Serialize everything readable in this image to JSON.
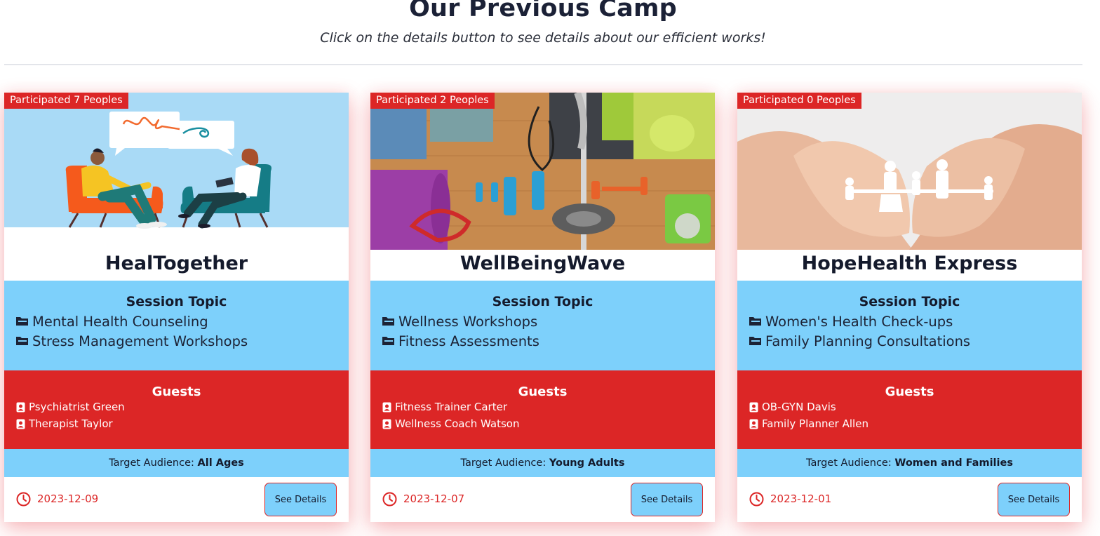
{
  "header": {
    "title": "Our Previous Camp",
    "subtitle": "Click on the details button to see details about our efficient works!"
  },
  "labels": {
    "session_topic": "Session Topic",
    "guests": "Guests",
    "target_audience": "Target Audience:",
    "see_details": "See Details"
  },
  "colors": {
    "primary_red": "#dc2626",
    "light_blue": "#7dd0fb",
    "title_dark": "#141a2c"
  },
  "camps": [
    {
      "participated": "Participated 7 Peoples",
      "image": "therapy-session-illustration",
      "name": "HealTogether",
      "topics": [
        "Mental Health Counseling",
        "Stress Management Workshops"
      ],
      "guests": [
        "Psychiatrist Green",
        "Therapist Taylor"
      ],
      "audience": "All Ages",
      "date": "2023-12-09"
    },
    {
      "participated": "Participated 2 Peoples",
      "image": "fitness-equipment-photo",
      "name": "WellBeingWave",
      "topics": [
        "Wellness Workshops",
        "Fitness Assessments"
      ],
      "guests": [
        "Fitness Trainer Carter",
        "Wellness Coach Watson"
      ],
      "audience": "Young Adults",
      "date": "2023-12-07"
    },
    {
      "participated": "Participated 0 Peoples",
      "image": "hands-holding-paper-family-photo",
      "name": "HopeHealth Express",
      "topics": [
        "Women's Health Check-ups",
        "Family Planning Consultations"
      ],
      "guests": [
        "OB-GYN Davis",
        "Family Planner Allen"
      ],
      "audience": "Women and Families",
      "date": "2023-12-01"
    }
  ]
}
